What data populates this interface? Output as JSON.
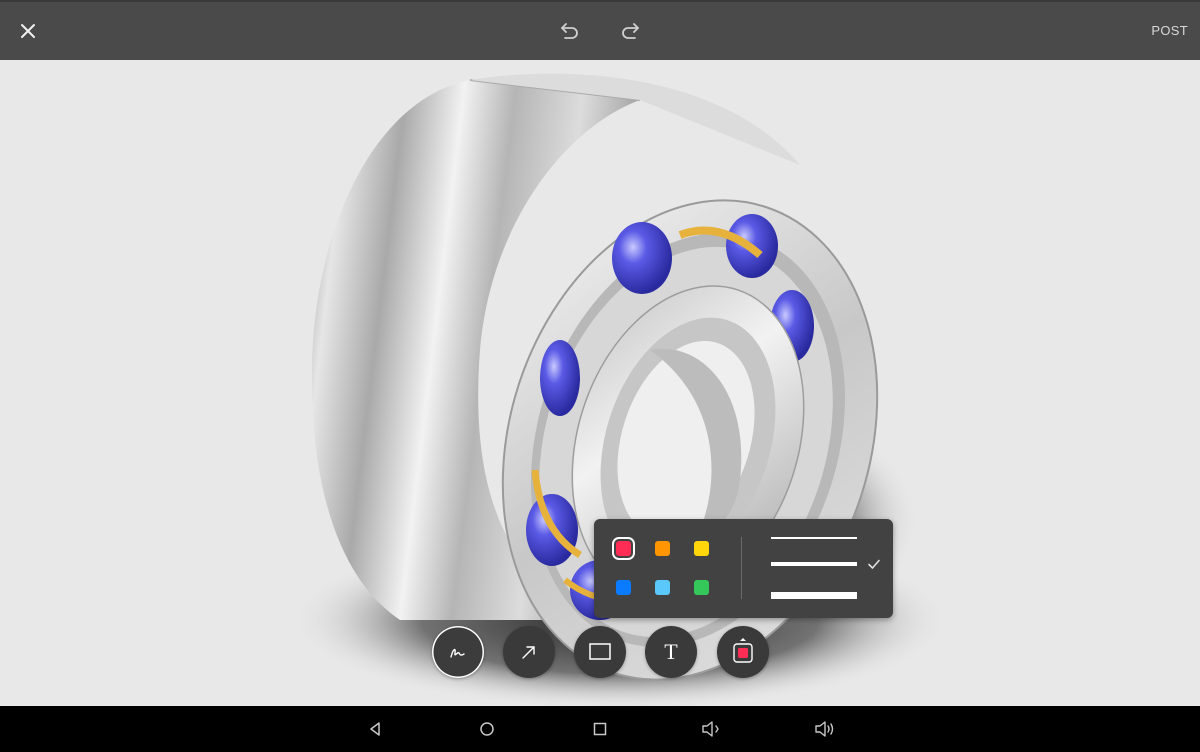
{
  "topbar": {
    "post_label": "POST",
    "icons": [
      "close-icon",
      "undo-icon",
      "redo-icon"
    ]
  },
  "palette": {
    "colors": [
      {
        "name": "red",
        "hex": "#ff2d55",
        "selected": true
      },
      {
        "name": "orange",
        "hex": "#ff9500",
        "selected": false
      },
      {
        "name": "yellow",
        "hex": "#ffd60a",
        "selected": false
      },
      {
        "name": "blue",
        "hex": "#0a7aff",
        "selected": false
      },
      {
        "name": "light-blue",
        "hex": "#5ac8fa",
        "selected": false
      },
      {
        "name": "green",
        "hex": "#34c759",
        "selected": false
      }
    ],
    "strokes": [
      "thin",
      "medium",
      "thick"
    ],
    "selected_stroke": "medium"
  },
  "tools": [
    {
      "name": "freehand-tool",
      "icon": "scribble-icon",
      "active": true
    },
    {
      "name": "arrow-tool",
      "icon": "arrow-icon",
      "active": false
    },
    {
      "name": "rectangle-tool",
      "icon": "rectangle-icon",
      "active": false
    },
    {
      "name": "text-tool",
      "icon": "text-icon",
      "glyph": "T",
      "active": false
    },
    {
      "name": "color-tool",
      "icon": "color-swatch-icon",
      "active": false
    }
  ],
  "current_color": "#ff2d55",
  "navbar": [
    "back-icon",
    "home-icon",
    "recents-icon",
    "volume-down-icon",
    "volume-up-icon"
  ]
}
